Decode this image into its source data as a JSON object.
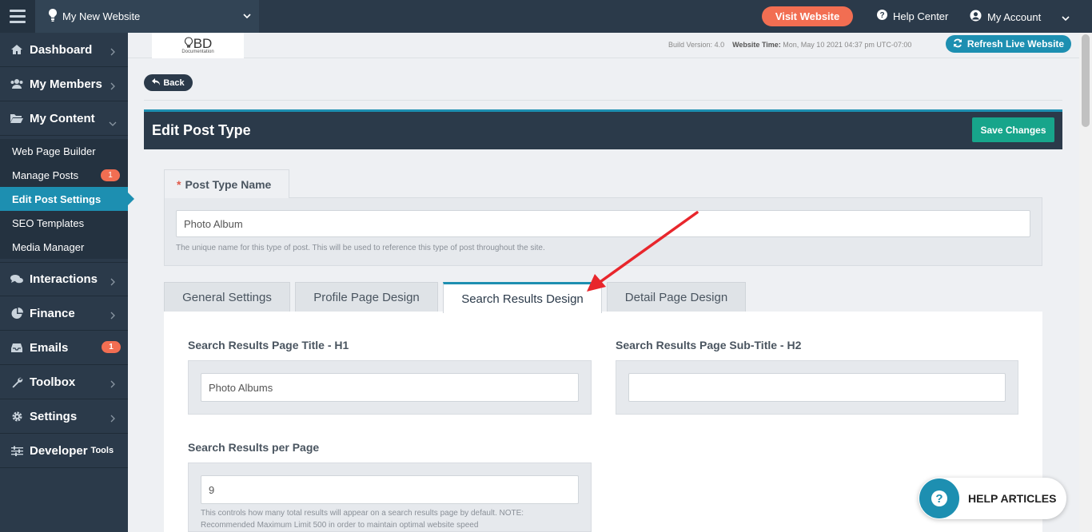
{
  "topbar": {
    "site_name": "My New Website",
    "visit_label": "Visit Website",
    "help_label": "Help Center",
    "account_label": "My Account"
  },
  "sidebar": {
    "items": [
      {
        "label": "Dashboard",
        "icon": "home-icon"
      },
      {
        "label": "My Members",
        "icon": "users-icon"
      },
      {
        "label": "My Content",
        "icon": "folder-open-icon"
      },
      {
        "label": "Interactions",
        "icon": "comments-icon"
      },
      {
        "label": "Finance",
        "icon": "pie-chart-icon"
      },
      {
        "label": "Emails",
        "icon": "inbox-icon",
        "badge": "1"
      },
      {
        "label": "Toolbox",
        "icon": "wrench-icon"
      },
      {
        "label": "Settings",
        "icon": "gear-icon"
      },
      {
        "label": "Developer",
        "suffix": "Tools",
        "icon": "sliders-icon"
      }
    ],
    "content_sub": [
      {
        "label": "Web Page Builder"
      },
      {
        "label": "Manage Posts",
        "badge": "1"
      },
      {
        "label": "Edit Post Settings",
        "active": true
      },
      {
        "label": "SEO Templates"
      },
      {
        "label": "Media Manager"
      }
    ]
  },
  "infobar": {
    "logo_main": "BD",
    "logo_sub": "Documentation",
    "build_label": "Build Version:",
    "build_value": "4.0",
    "time_label": "Website Time:",
    "time_value": "Mon, May 10 2021 04:37 pm UTC-07:00",
    "refresh_label": "Refresh Live Website"
  },
  "back_label": "Back",
  "panel": {
    "title": "Edit Post Type",
    "save_label": "Save Changes"
  },
  "post_type": {
    "label": "Post Type Name",
    "required_mark": "*",
    "value": "Photo Album",
    "hint": "The unique name for this type of post. This will be used to reference this type of post throughout the site."
  },
  "tabs": [
    {
      "label": "General Settings"
    },
    {
      "label": "Profile Page Design"
    },
    {
      "label": "Search Results Design",
      "active": true
    },
    {
      "label": "Detail Page Design"
    }
  ],
  "fields": {
    "h1_label": "Search Results Page Title - H1",
    "h1_value": "Photo Albums",
    "h2_label": "Search Results Page Sub-Title - H2",
    "h2_value": "",
    "per_page_label": "Search Results per Page",
    "per_page_value": "9",
    "per_page_hint": "This controls how many total results will appear on a search results page by default. NOTE: Recommended Maximum Limit 500 in order to maintain optimal website speed"
  },
  "help_articles_label": "HELP ARTICLES",
  "colors": {
    "sidebar_bg": "#2b3a4a",
    "accent": "#1d8fb1",
    "visit_button": "#f26e52",
    "save_button": "#17a58b",
    "annotation_arrow": "#e8262c"
  }
}
